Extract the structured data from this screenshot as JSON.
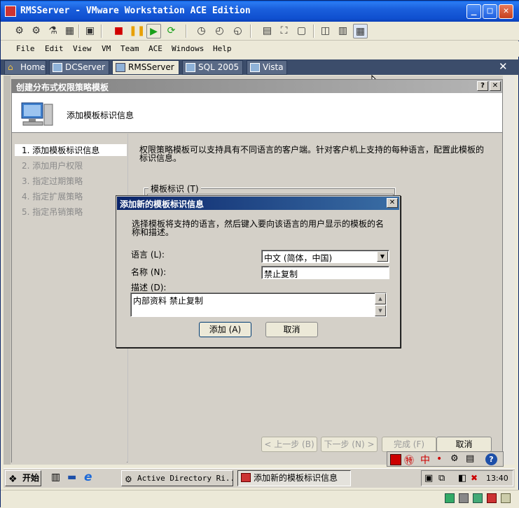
{
  "vm_window": {
    "title": "RMSServer - VMware Workstation ACE Edition",
    "menu": [
      "File",
      "Edit",
      "View",
      "VM",
      "Team",
      "ACE",
      "Windows",
      "Help"
    ],
    "tabs": [
      "Home",
      "DCServer",
      "RMSServer",
      "SQL 2005",
      "Vista"
    ],
    "active_tab": "RMSServer",
    "tab_close_glyph": "✕",
    "minimize_glyph": "_",
    "maximize_glyph": "□",
    "close_glyph": "✕"
  },
  "wizard": {
    "title": "创建分布式权限策略模板",
    "help_glyph": "?",
    "close_glyph": "✕",
    "header": "添加模板标识信息",
    "steps": [
      "1. 添加模板标识信息",
      "2. 添加用户权限",
      "3. 指定过期策略",
      "4. 指定扩展策略",
      "5. 指定吊销策略"
    ],
    "description": "权限策略模板可以支持具有不同语言的客户端。针对客户机上支持的每种语言，配置此模板的标识信息。",
    "group_label": "模板标识 (T)",
    "buttons": {
      "back": "< 上一步 (B)",
      "next": "下一步 (N) >",
      "finish": "完成 (F)",
      "cancel": "取消"
    }
  },
  "dialog": {
    "title": "添加新的模板标识信息",
    "close_glyph": "✕",
    "instruction": "选择模板将支持的语言，然后键入要向该语言的用户显示的模板的名称和描述。",
    "language_label": "语言 (L):",
    "language_value": "中文 (简体，中国)",
    "name_label": "名称 (N):",
    "name_value": "禁止复制",
    "desc_label": "描述 (D):",
    "desc_value": "内部资料 禁止复制",
    "add_button": "添加 (A)",
    "cancel_button": "取消"
  },
  "taskbar": {
    "start": "开始",
    "tasks": [
      "Active Directory Ri...",
      "添加新的模板标识信息"
    ],
    "clock": "13:40",
    "ime_label": "中"
  }
}
